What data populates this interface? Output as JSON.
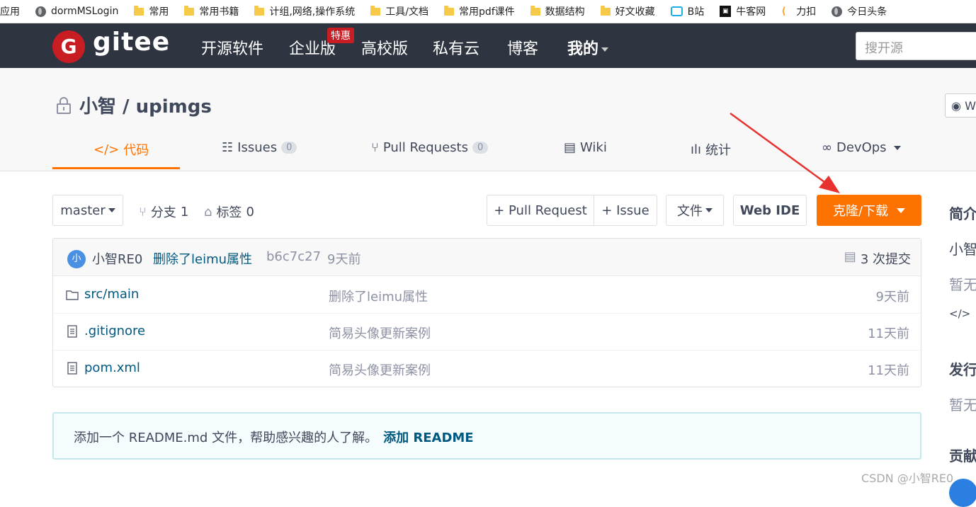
{
  "bookmarks": [
    {
      "label": "应用",
      "icon": "apps-icon"
    },
    {
      "label": "dormMSLogin",
      "icon": "globe-icon"
    },
    {
      "label": "常用",
      "icon": "folder-icon"
    },
    {
      "label": "常用书籍",
      "icon": "folder-icon"
    },
    {
      "label": "计组,网络,操作系统",
      "icon": "folder-icon"
    },
    {
      "label": "工具/文档",
      "icon": "folder-icon"
    },
    {
      "label": "常用pdf课件",
      "icon": "folder-icon"
    },
    {
      "label": "数据结构",
      "icon": "folder-icon"
    },
    {
      "label": "好文收藏",
      "icon": "folder-icon"
    },
    {
      "label": "B站",
      "icon": "bilibili-icon"
    },
    {
      "label": "牛客网",
      "icon": "nowcoder-icon"
    },
    {
      "label": "力扣",
      "icon": "leetcode-icon"
    },
    {
      "label": "今日头条",
      "icon": "globe-icon"
    }
  ],
  "header": {
    "logo_text": "gitee",
    "nav": [
      "开源软件",
      "企业版",
      "高校版",
      "私有云",
      "博客",
      "我的"
    ],
    "promo_badge": "特惠",
    "search_placeholder": "搜开源"
  },
  "repo": {
    "title": "小智 / upimgs",
    "watch_label": "W",
    "tabs": [
      {
        "label": "代码",
        "count": ""
      },
      {
        "label": "Issues",
        "count": "0"
      },
      {
        "label": "Pull Requests",
        "count": "0"
      },
      {
        "label": "Wiki",
        "count": ""
      },
      {
        "label": "统计",
        "count": ""
      },
      {
        "label": "DevOps",
        "count": ""
      }
    ]
  },
  "toolbar": {
    "branch": "master",
    "branches_label": "分支",
    "branches_count": "1",
    "tags_label": "标签",
    "tags_count": "0",
    "pull_request_btn": "+ Pull Request",
    "issue_btn": "+ Issue",
    "file_btn": "文件",
    "webide_btn": "Web IDE",
    "clone_btn": "克隆/下载"
  },
  "commit": {
    "avatar_char": "小",
    "author": "小智RE0",
    "message": "删除了leimu属性",
    "hash": "b6c7c27",
    "time": "9天前",
    "total": "3 次提交"
  },
  "files": [
    {
      "name": "src/main",
      "type": "folder",
      "message": "删除了leimu属性",
      "time": "9天前"
    },
    {
      "name": ".gitignore",
      "type": "file",
      "message": "简易头像更新案例",
      "time": "11天前"
    },
    {
      "name": "pom.xml",
      "type": "file",
      "message": "简易头像更新案例",
      "time": "11天前"
    }
  ],
  "readme_notice": {
    "text": "添加一个 README.md 文件，帮助感兴趣的人了解。",
    "link": "添加 README"
  },
  "sidebar": {
    "intro_title": "简介",
    "intro_author": "小智",
    "intro_empty": "暂无",
    "release_title": "发行",
    "release_empty": "暂无",
    "contrib_title": "贡献"
  },
  "watermark": "CSDN @小智RE0",
  "colors": {
    "accent": "#fe7300",
    "header_bg": "#2e3440",
    "link": "#005980",
    "annotation_arrow": "#e8322f"
  }
}
